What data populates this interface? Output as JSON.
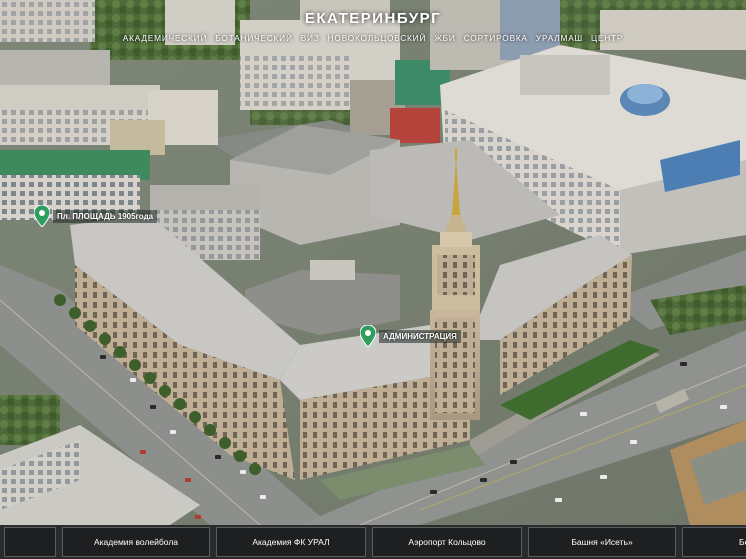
{
  "city": {
    "title": "ЕКАТЕРИНБУРГ"
  },
  "districts": [
    "АКАДЕМИЧЕСКИЙ",
    "БОТАНИЧЕСКИЙ",
    "ВИЗ",
    "НОВОКОЛЬЦОВСКИЙ",
    "ЖБИ",
    "СОРТИРОВКА",
    "УРАЛМАШ",
    "ЦЕНТР"
  ],
  "markers": {
    "square": {
      "label": "Пл. ПЛОЩАДЬ 1905года",
      "icon": "map-pin-icon",
      "color": "#2f9e5f"
    },
    "admin": {
      "label": "АДМИНИСТРАЦИЯ",
      "icon": "map-pin-icon",
      "color": "#2f9e5f"
    }
  },
  "bottom_nav": [
    "",
    "Академия волейбола",
    "Академия ФК УРАЛ",
    "Аэропорт Кольцово",
    "Башня «Исеть»",
    "Бел"
  ]
}
